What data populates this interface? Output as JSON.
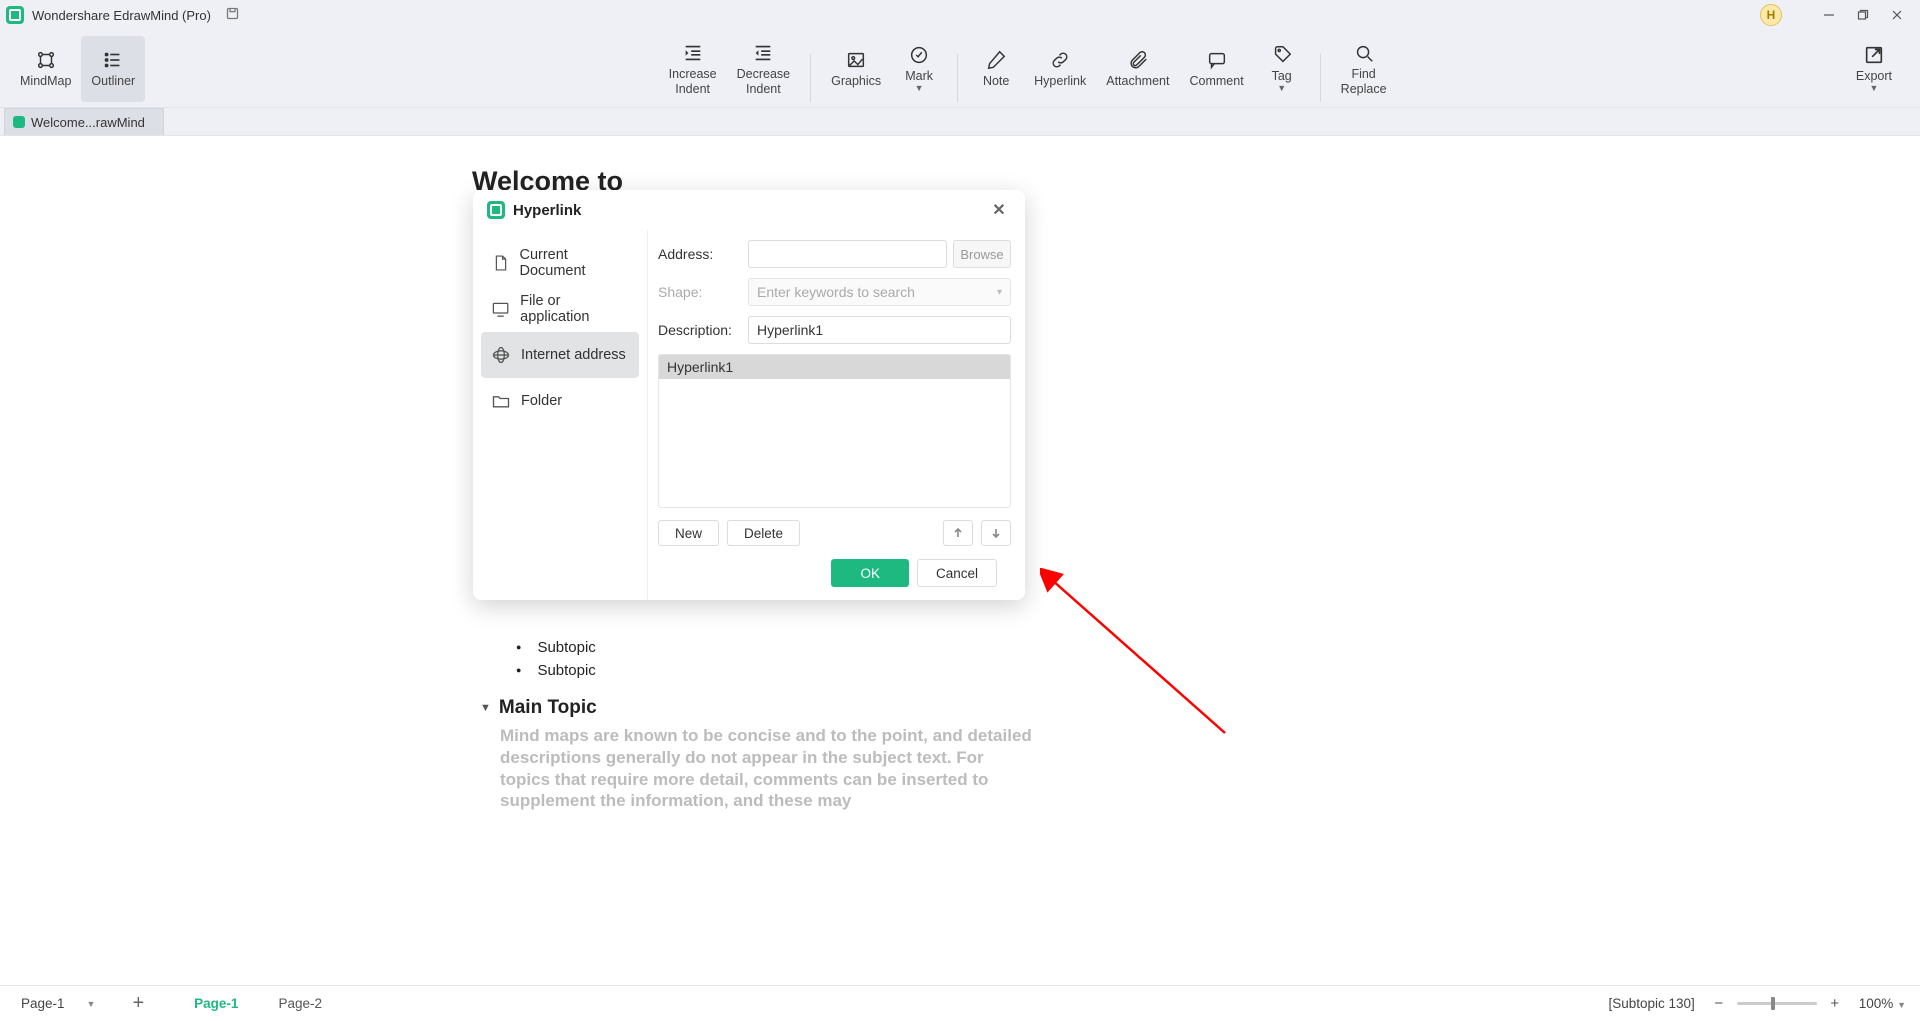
{
  "titlebar": {
    "app_title": "Wondershare EdrawMind (Pro)",
    "user_initial": "H"
  },
  "toolbar": {
    "mindmap": "MindMap",
    "outliner": "Outliner",
    "inc_indent_l1": "Increase",
    "inc_indent_l2": "Indent",
    "dec_indent_l1": "Decrease",
    "dec_indent_l2": "Indent",
    "graphics": "Graphics",
    "mark": "Mark",
    "note": "Note",
    "hyperlink": "Hyperlink",
    "attachment": "Attachment",
    "comment": "Comment",
    "tag": "Tag",
    "find_l1": "Find",
    "find_l2": "Replace",
    "export": "Export"
  },
  "file_tab": "Welcome...rawMind",
  "outline": {
    "title": "Welcome to",
    "sub1": "Subtopic",
    "sub2": "Subtopic",
    "main_topic": "Main Topic",
    "desc": "Mind maps are known to be concise and to the point, and detailed descriptions generally do not appear in the subject text. For topics that require more detail, comments can be inserted to supplement the information, and these may"
  },
  "dialog": {
    "title": "Hyperlink",
    "side": {
      "current_doc": "Current Document",
      "file_app": "File or application",
      "internet": "Internet address",
      "folder": "Folder"
    },
    "address_label": "Address:",
    "browse": "Browse",
    "shape_label": "Shape:",
    "shape_placeholder": "Enter keywords to search",
    "desc_label": "Description:",
    "desc_value": "Hyperlink1",
    "list_item": "Hyperlink1",
    "new": "New",
    "delete": "Delete",
    "ok": "OK",
    "cancel": "Cancel"
  },
  "status": {
    "page_select": "Page-1",
    "page_tabs": [
      "Page-1",
      "Page-2"
    ],
    "subtopic": "[Subtopic 130]",
    "zoom": "100%"
  }
}
